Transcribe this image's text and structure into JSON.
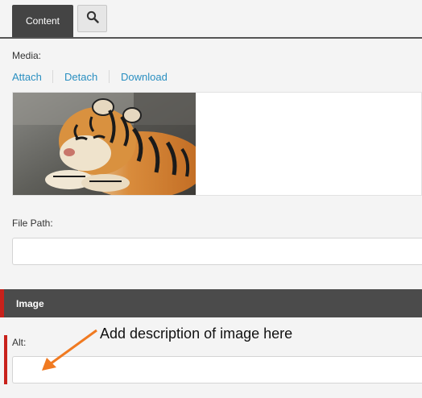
{
  "tabs": {
    "content_label": "Content",
    "search_icon": "magnifier-icon"
  },
  "media": {
    "label": "Media:",
    "actions": [
      {
        "label": "Attach"
      },
      {
        "label": "Detach"
      },
      {
        "label": "Download"
      }
    ],
    "thumbnail": "tiger-photo"
  },
  "file_path": {
    "label": "File Path:",
    "value": "",
    "placeholder": ""
  },
  "image_section": {
    "title": "Image",
    "alt_label": "Alt:",
    "alt_value": "",
    "alt_placeholder": ""
  },
  "annotation": {
    "text": "Add description of image here",
    "arrow_color": "#f07a21"
  },
  "colors": {
    "link": "#2a8fc1",
    "required": "#c8211b",
    "section_bar": "#4b4b4b",
    "active_tab": "#444444"
  }
}
